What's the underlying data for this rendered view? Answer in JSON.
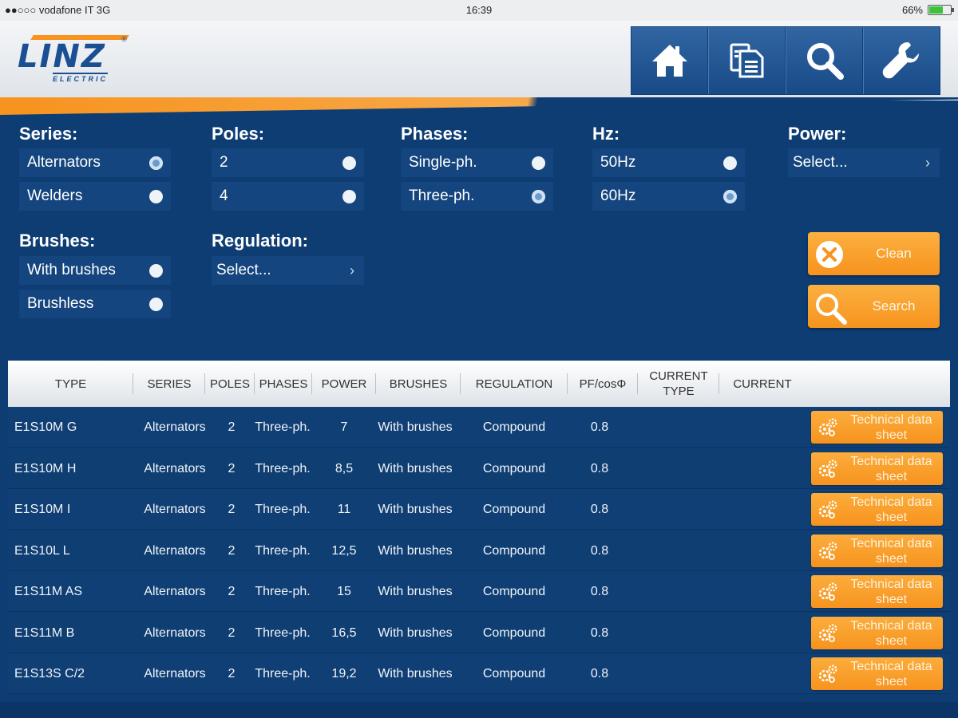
{
  "status_bar": {
    "carrier": "●●○○○ vodafone IT  3G",
    "time": "16:39",
    "battery": "66%",
    "battery_level": 0.66
  },
  "logo": {
    "word": "LINZ",
    "sub": "ELECTRIC",
    "reg": "®"
  },
  "nav": {
    "items": [
      {
        "name": "home",
        "icon": "home-icon"
      },
      {
        "name": "documents",
        "icon": "documents-icon"
      },
      {
        "name": "search",
        "icon": "search-icon"
      },
      {
        "name": "settings",
        "icon": "wrench-icon"
      }
    ]
  },
  "filters": {
    "series": {
      "label": "Series:",
      "options": [
        {
          "label": "Alternators",
          "selected": true
        },
        {
          "label": "Welders",
          "selected": false
        }
      ]
    },
    "poles": {
      "label": "Poles:",
      "options": [
        {
          "label": "2",
          "selected": false
        },
        {
          "label": "4",
          "selected": false
        }
      ]
    },
    "phases": {
      "label": "Phases:",
      "options": [
        {
          "label": "Single-ph.",
          "selected": false
        },
        {
          "label": "Three-ph.",
          "selected": true
        }
      ]
    },
    "hz": {
      "label": "Hz:",
      "options": [
        {
          "label": "50Hz",
          "selected": false
        },
        {
          "label": "60Hz",
          "selected": true
        }
      ]
    },
    "power": {
      "label": "Power:",
      "value": "Select..."
    },
    "brushes": {
      "label": "Brushes:",
      "options": [
        {
          "label": "With brushes",
          "selected": false
        },
        {
          "label": "Brushless",
          "selected": false
        }
      ]
    },
    "regulation": {
      "label": "Regulation:",
      "value": "Select..."
    }
  },
  "actions": {
    "clean": "Clean",
    "search": "Search"
  },
  "table": {
    "headers": [
      "TYPE",
      "SERIES",
      "POLES",
      "PHASES",
      "POWER",
      "BRUSHES",
      "REGULATION",
      "PF/cosΦ",
      "CURRENT TYPE",
      "CURRENT"
    ],
    "button_label": "Technical data sheet",
    "rows": [
      {
        "type": "E1S10M G",
        "series": "Alternators",
        "poles": "2",
        "phases": "Three-ph.",
        "power": "7",
        "brushes": "With brushes",
        "regulation": "Compound",
        "pf": "0.8"
      },
      {
        "type": "E1S10M H",
        "series": "Alternators",
        "poles": "2",
        "phases": "Three-ph.",
        "power": "8,5",
        "brushes": "With brushes",
        "regulation": "Compound",
        "pf": "0.8"
      },
      {
        "type": "E1S10M I",
        "series": "Alternators",
        "poles": "2",
        "phases": "Three-ph.",
        "power": "11",
        "brushes": "With brushes",
        "regulation": "Compound",
        "pf": "0.8"
      },
      {
        "type": "E1S10L L",
        "series": "Alternators",
        "poles": "2",
        "phases": "Three-ph.",
        "power": "12,5",
        "brushes": "With brushes",
        "regulation": "Compound",
        "pf": "0.8"
      },
      {
        "type": "E1S11M AS",
        "series": "Alternators",
        "poles": "2",
        "phases": "Three-ph.",
        "power": "15",
        "brushes": "With brushes",
        "regulation": "Compound",
        "pf": "0.8"
      },
      {
        "type": "E1S11M B",
        "series": "Alternators",
        "poles": "2",
        "phases": "Three-ph.",
        "power": "16,5",
        "brushes": "With brushes",
        "regulation": "Compound",
        "pf": "0.8"
      },
      {
        "type": "E1S13S C/2",
        "series": "Alternators",
        "poles": "2",
        "phases": "Three-ph.",
        "power": "19,2",
        "brushes": "With brushes",
        "regulation": "Compound",
        "pf": "0.8"
      }
    ]
  },
  "colors": {
    "background": "#0d3d73",
    "accent": "#f7931e",
    "brand": "#1b4f93"
  }
}
